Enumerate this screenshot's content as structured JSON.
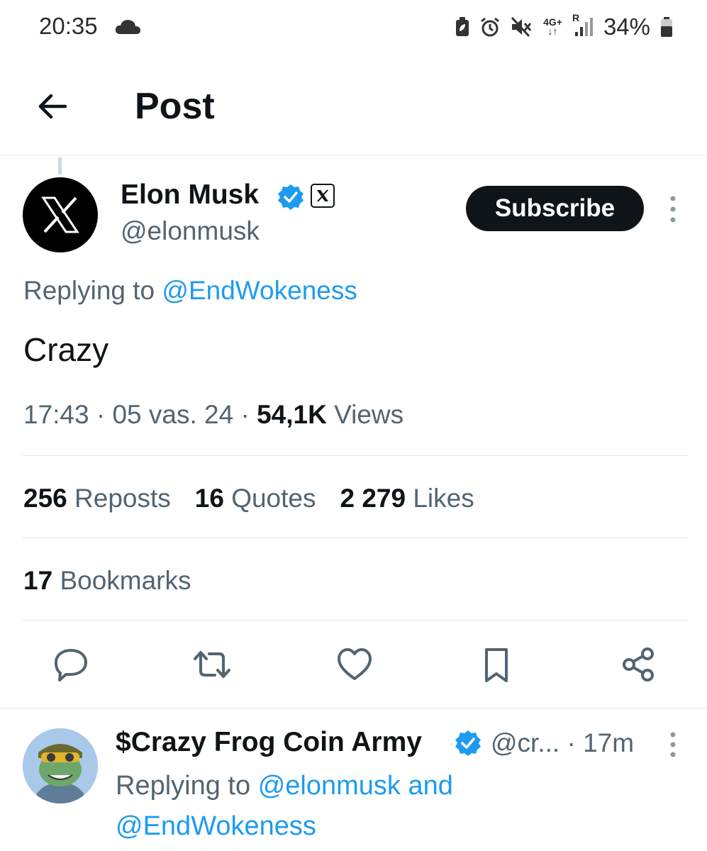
{
  "status_bar": {
    "time": "20:35",
    "network_type": "4G+",
    "roaming": "R",
    "battery_percent": "34%",
    "icons": [
      "cloud-icon",
      "battery-saver-icon",
      "alarm-icon",
      "mute-icon",
      "signal-icon",
      "battery-icon"
    ]
  },
  "header": {
    "title": "Post",
    "back_icon": "arrow-left-icon"
  },
  "post": {
    "author_name": "Elon Musk",
    "author_handle": "@elonmusk",
    "subscribe_label": "Subscribe",
    "replying_prefix": "Replying to",
    "replying_to": "@EndWokeness",
    "text": "Crazy",
    "time": "17:43",
    "date": "05 vas. 24",
    "views_count": "54,1K",
    "views_label": "Views",
    "separator": "·",
    "stats": {
      "reposts_count": "256",
      "reposts_label": "Reposts",
      "quotes_count": "16",
      "quotes_label": "Quotes",
      "likes_count": "2 279",
      "likes_label": "Likes",
      "bookmarks_count": "17",
      "bookmarks_label": "Bookmarks"
    },
    "actions": [
      "reply-icon",
      "repost-icon",
      "like-icon",
      "bookmark-icon",
      "share-icon"
    ]
  },
  "reply": {
    "author_name": "$Crazy Frog Coin Army",
    "author_handle": "@cr...",
    "time_ago": "· 17m",
    "replying_prefix": "Replying to",
    "mention_1": "@elonmusk and",
    "mention_2": "@EndWokeness"
  },
  "colors": {
    "accent": "#1d9bf0",
    "text_primary": "#0f1419",
    "text_secondary": "#536471",
    "divider": "#e1e6ea",
    "button_dark": "#0f1419"
  }
}
